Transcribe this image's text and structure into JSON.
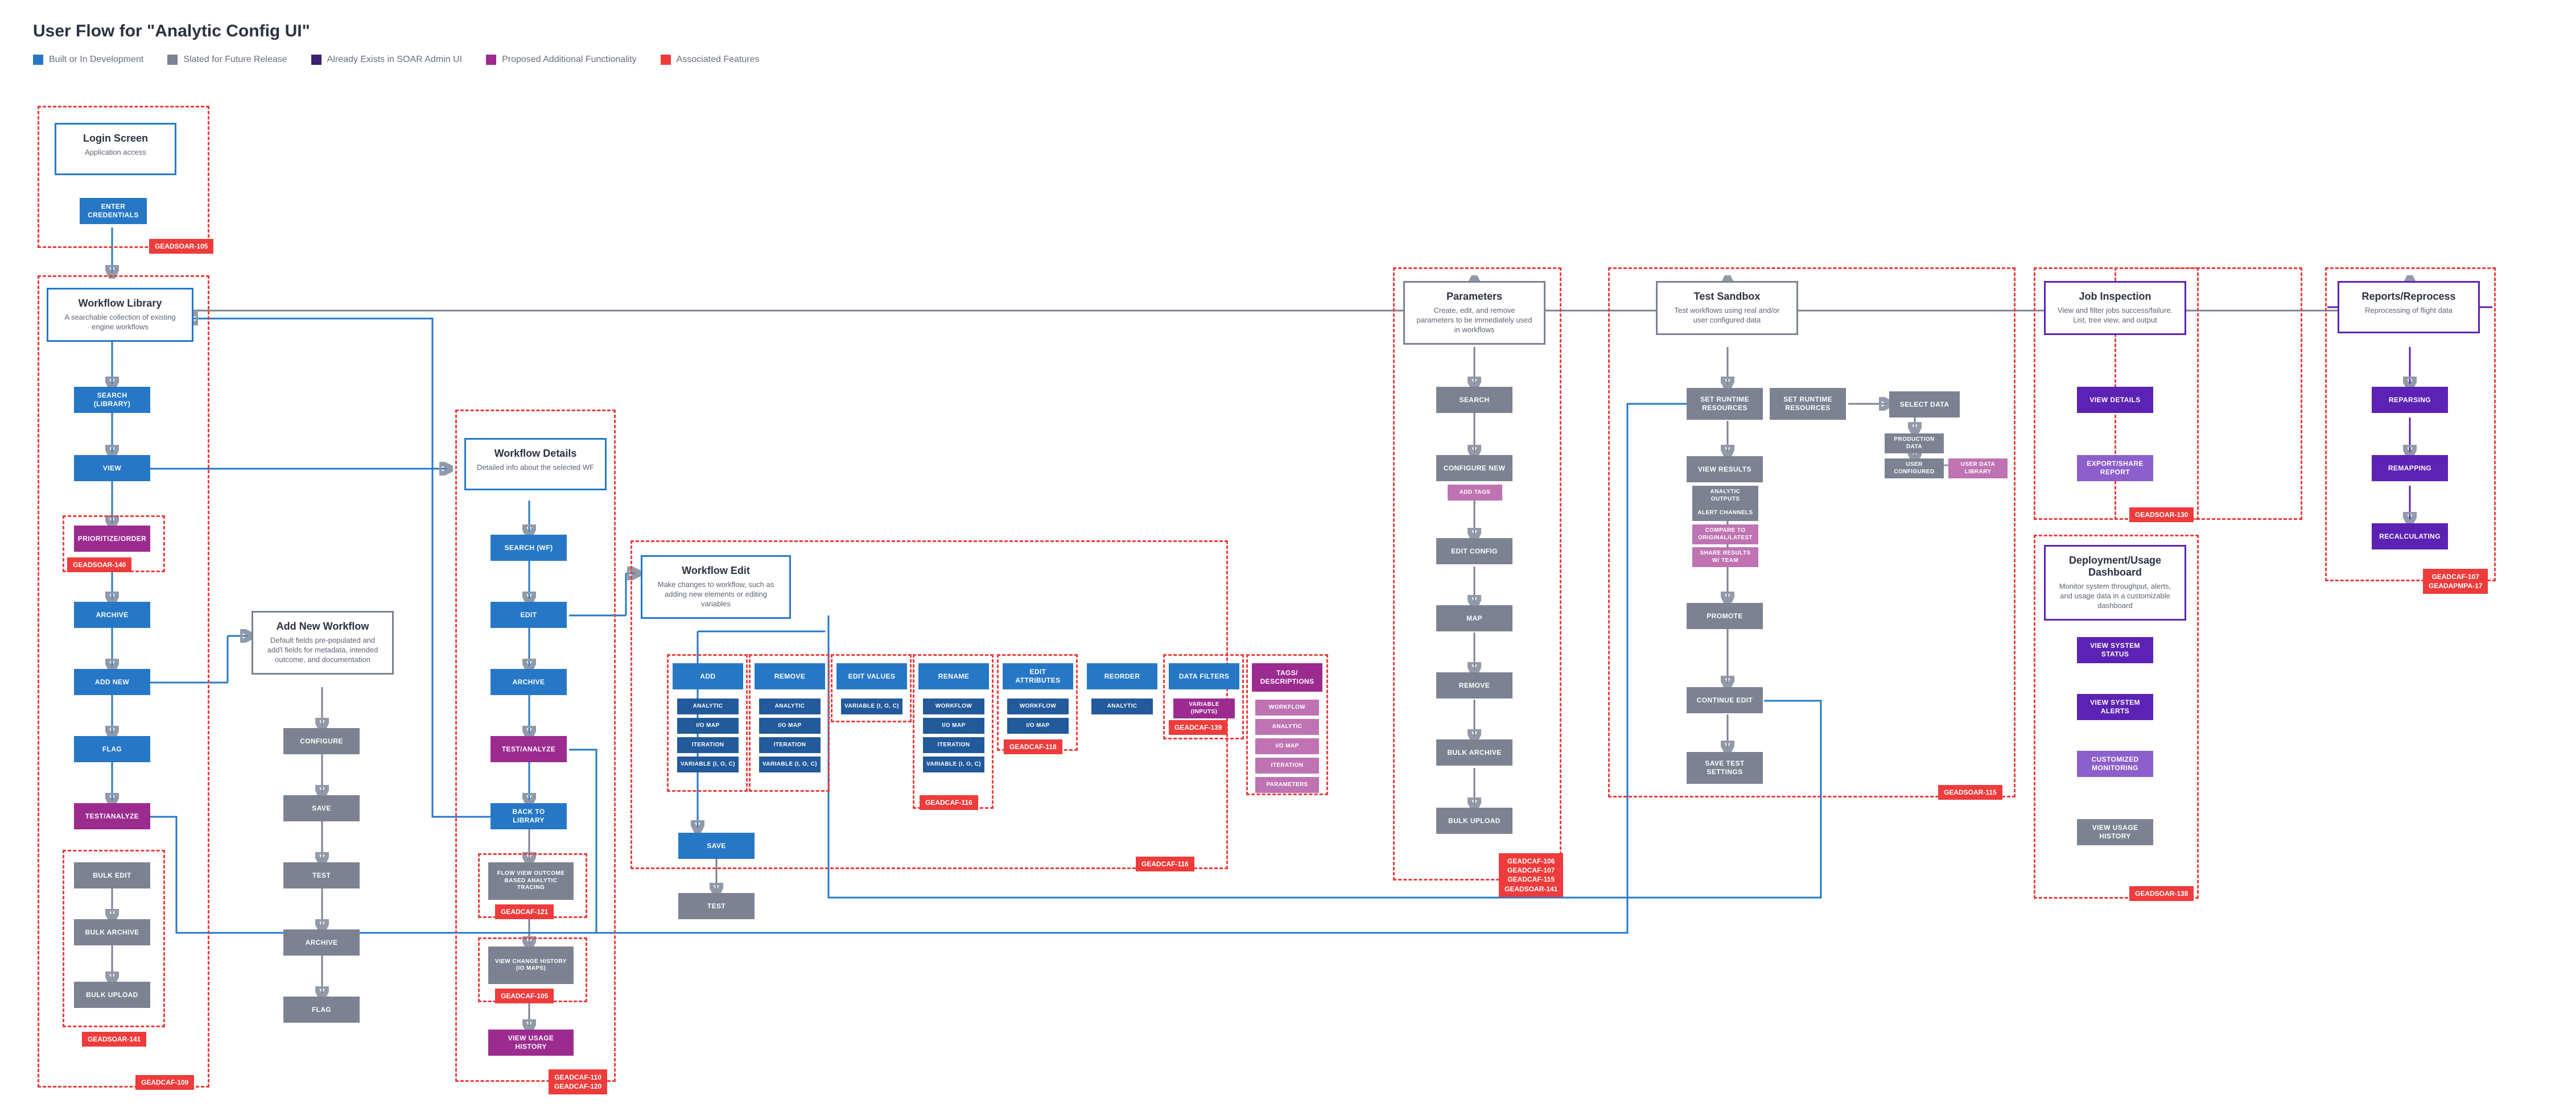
{
  "title": "User Flow for \"Analytic Config UI\"",
  "legend": [
    {
      "label": "Built or In Development",
      "color": "#2678C6"
    },
    {
      "label": "Slated for Future Release",
      "color": "#7C8291"
    },
    {
      "label": "Already Exists in SOAR Admin UI",
      "color": "#5B22B4"
    },
    {
      "label": "Proposed Additional Functionality",
      "color": "#9B2B8F"
    },
    {
      "label": "Associated Features",
      "color": "#EE3B3B"
    }
  ],
  "login": {
    "title": "Login Screen",
    "desc": "Application access",
    "enter": "ENTER CREDENTIALS",
    "tag": "GEADSOAR-105"
  },
  "library": {
    "title": "Workflow Library",
    "desc": "A searchable collection of existing engine workflows",
    "search": "SEARCH (Library)",
    "view": "VIEW",
    "prioritize": "PRIORITIZE/ORDER",
    "prioritize_tag": "GEADSOAR-140",
    "archive": "ARCHIVE",
    "addnew": "ADD NEW",
    "flag": "FLAG",
    "test": "TEST/ANALYZE",
    "bulkedit": "BULK EDIT",
    "bulkarchive": "BULK ARCHIVE",
    "bulkupload": "BULK UPLOAD",
    "bulk_tag": "GEADSOAR-141",
    "group_tag": "GEADCAF-109"
  },
  "addnew": {
    "title": "Add New Workflow",
    "desc": "Default fields pre-populated and add'l fields for metadata, intended outcome, and documentation",
    "configure": "CONFIGURE",
    "save": "SAVE",
    "test": "TEST",
    "archive": "ARCHIVE",
    "flag": "FLAG"
  },
  "details": {
    "title": "Workflow Details",
    "desc": "Detailed info about the selected WF",
    "searchwf": "SEARCH (WF)",
    "edit": "EDIT",
    "archive": "ARCHIVE",
    "test": "TEST/ANALYZE",
    "back": "BACK TO LIBRARY",
    "flowview": "FLOW VIEW Outcome Based Analytic Tracing",
    "flowview_tag": "GEADCAF-121",
    "changehistory": "VIEW CHANGE HISTORY (IO Maps)",
    "changehistory_tag": "GEADCAF-105",
    "usage": "VIEW USAGE HISTORY",
    "group_tags": "GEADCAF-110\nGEADCAF-120"
  },
  "edit": {
    "title": "Workflow Edit",
    "desc": "Make changes to workflow, such as adding new elements or editing variables",
    "add": "ADD",
    "remove": "REMOVE",
    "editvalues": "EDIT VALUES",
    "rename": "RENAME",
    "editattrs": "EDIT ATTRIBUTES",
    "reorder": "REORDER",
    "datafilters": "DATA FILTERS",
    "tags": "TAGS/ DESCRIPTIONS",
    "save": "SAVE",
    "test": "TEST",
    "subs": {
      "analytic": "Analytic",
      "iomap": "I/O Map",
      "iteration": "Iteration",
      "variable": "Variable (I, O, C)",
      "varinputs": "Variable (Inputs)",
      "workflow": "Workflow",
      "parameters": "Parameters"
    },
    "tags_issue118": "GEADCAF-118",
    "tags_issue116r": "GEADCAF-116",
    "tags_issue139": "GEADCAF-139",
    "group_tag": "GEADCAF-116"
  },
  "tagsdesc": {
    "workflow": "Workflow",
    "analytic": "Analytic",
    "iomap": "I/O Map",
    "iteration": "Iteration",
    "parameters": "Parameters"
  },
  "parameters": {
    "title": "Parameters",
    "desc": "Create, edit, and remove parameters to be immediately used in workflows",
    "search": "SEARCH",
    "configure": "CONFIGURE NEW",
    "addtags": "Add Tags",
    "editconfig": "EDIT CONFIG",
    "map": "MAP",
    "remove": "REMOVE",
    "bulkarchive": "BULK ARCHIVE",
    "bulkupload": "BULK UPLOAD",
    "group_tags": "GEADCAF-106\nGEADCAF-107\nGEADCAF-115\nGEADSOAR-141"
  },
  "sandbox": {
    "title": "Test Sandbox",
    "desc": "Test workflows using real and/or user configured data",
    "setrr": "SET RUNTIME RESOURCES",
    "selectdata": "SELECT DATA",
    "prod": "Production Data",
    "userconf": "User Configured",
    "userlib": "User Data Library",
    "view": "VIEW RESULTS",
    "outputs": "Analytic Outputs",
    "alert": "Alert Channels",
    "compare": "Compare to Original/Latest",
    "share": "Share Results w/ Team",
    "promote": "PROMOTE",
    "continue": "CONTINUE EDIT",
    "savesettings": "SAVE TEST SETTINGS",
    "group_tag": "GEADSOAR-115"
  },
  "reports": {
    "title": "Reports/Reprocess",
    "desc": "Reprocessing of flight data",
    "reparsing": "REPARSING",
    "remapping": "REMAPPING",
    "recalc": "RECALCULATING",
    "group_tags": "GEADCAF-107\nGEADAPMPA-17"
  },
  "jobs": {
    "title": "Job Inspection",
    "desc": "View and filter jobs success/failure. List, tree view, and output",
    "viewdetails": "VIEW DETAILS",
    "export": "EXPORT/SHARE REPORT",
    "group_tag": "GEADSOAR-130"
  },
  "dash": {
    "title": "Deployment/Usage Dashboard",
    "desc": "Monitor system throughput, alerts, and usage data in a customizable dashboard",
    "status": "VIEW SYSTEM STATUS",
    "alerts": "VIEW SYSTEM ALERTS",
    "custommon": "CUSTOMIZED MONITORING",
    "usagehist": "VIEW USAGE HISTORY",
    "group_tag": "GEADSOAR-138"
  }
}
